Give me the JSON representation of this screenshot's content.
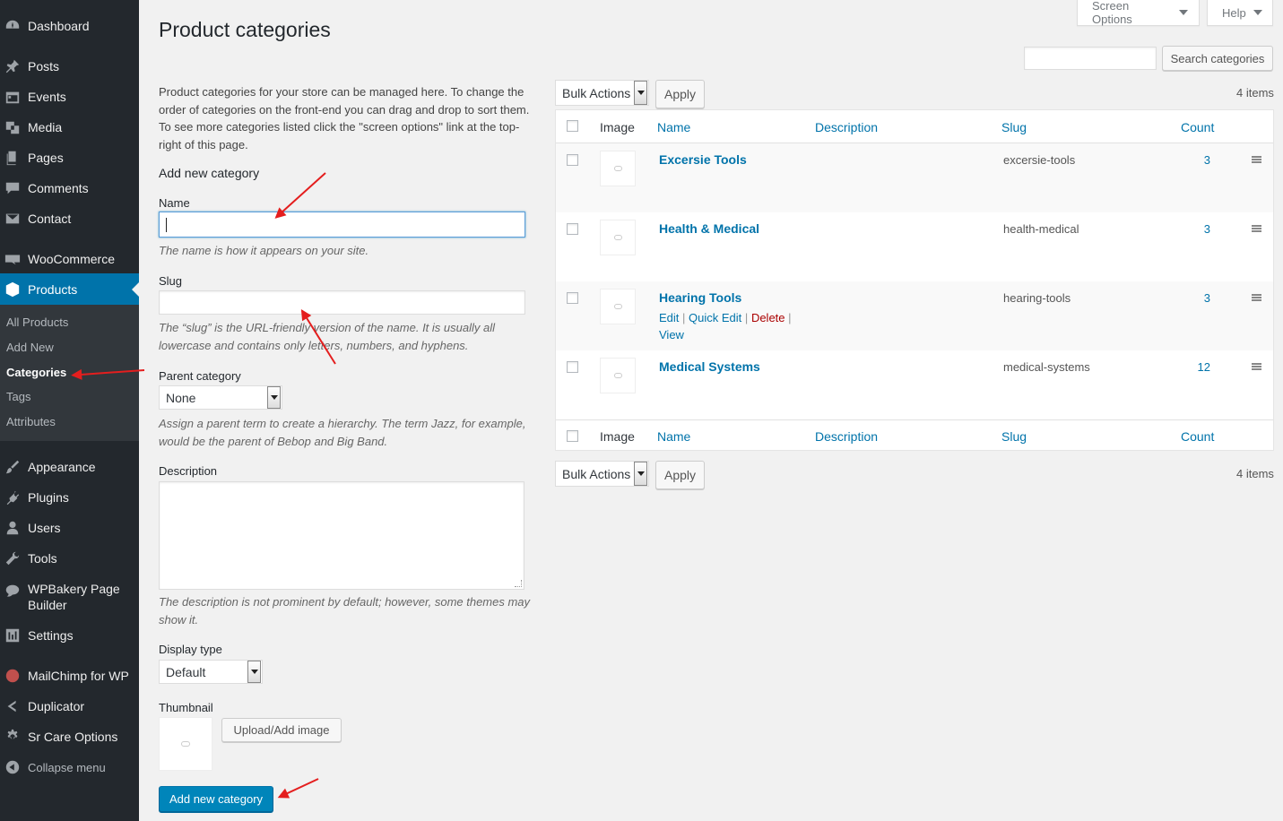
{
  "top_buttons": {
    "screen_options": "Screen Options",
    "help": "Help"
  },
  "page_title": "Product categories",
  "search_button": "Search categories",
  "intro_text": "Product categories for your store can be managed here. To change the order of categories on the front-end you can drag and drop to sort them. To see more categories listed click the \"screen options\" link at the top-right of this page.",
  "form": {
    "heading": "Add new category",
    "name_label": "Name",
    "name_help": "The name is how it appears on your site.",
    "slug_label": "Slug",
    "slug_help": "The “slug” is the URL-friendly version of the name. It is usually all lowercase and contains only letters, numbers, and hyphens.",
    "parent_label": "Parent category",
    "parent_value": "None",
    "parent_help": "Assign a parent term to create a hierarchy. The term Jazz, for example, would be the parent of Bebop and Big Band.",
    "description_label": "Description",
    "description_help": "The description is not prominent by default; however, some themes may show it.",
    "display_label": "Display type",
    "display_value": "Default",
    "thumbnail_label": "Thumbnail",
    "upload_button": "Upload/Add image",
    "submit_button": "Add new category"
  },
  "menu": {
    "dashboard": "Dashboard",
    "posts": "Posts",
    "events": "Events",
    "media": "Media",
    "pages": "Pages",
    "comments": "Comments",
    "contact": "Contact",
    "woocommerce": "WooCommerce",
    "products": "Products",
    "sub": {
      "all": "All Products",
      "add": "Add New",
      "categories": "Categories",
      "tags": "Tags",
      "attributes": "Attributes"
    },
    "appearance": "Appearance",
    "plugins": "Plugins",
    "users": "Users",
    "tools": "Tools",
    "wpbakery1": "WPBakery Page",
    "wpbakery2": "Builder",
    "settings": "Settings",
    "mailchimp": "MailChimp for WP",
    "duplicator": "Duplicator",
    "srcare": "Sr Care Options",
    "collapse": "Collapse menu"
  },
  "table": {
    "bulk_label": "Bulk Actions",
    "apply_label": "Apply",
    "items_count": "4 items",
    "columns": {
      "image": "Image",
      "name": "Name",
      "description": "Description",
      "slug": "Slug",
      "count": "Count"
    },
    "rows": [
      {
        "name": "Excersie Tools",
        "slug": "excersie-tools",
        "count": "3"
      },
      {
        "name": "Health & Medical",
        "slug": "health-medical",
        "count": "3"
      },
      {
        "name": "Hearing Tools",
        "slug": "hearing-tools",
        "count": "3"
      },
      {
        "name": "Medical Systems",
        "slug": "medical-systems",
        "count": "12"
      }
    ],
    "row_actions": {
      "edit": "Edit",
      "quick_edit": "Quick Edit",
      "delete": "Delete",
      "view": "View"
    }
  },
  "colors": {
    "sidebar": "#23282d",
    "submenu": "#32373c",
    "accent": "#0073aa",
    "annotation_arrow": "#e41e1e",
    "delete": "#aa0000"
  }
}
